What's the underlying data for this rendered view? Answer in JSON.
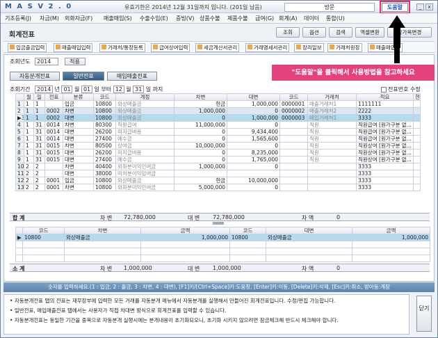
{
  "app": {
    "logo": "M A S  V 2 . 0",
    "notice": "유효기한은 2014년 12월 31일까지 입니다. (201일 남음)",
    "visitor": "방문",
    "help": "도움말",
    "win_min": "_",
    "win_close": "x"
  },
  "menu": [
    "기초등록(J)",
    "자금(M)",
    "외화자금(F)",
    "매출매입(S)",
    "수출수입(E)",
    "증빙(V)",
    "상품수불",
    "제품수불",
    "급여(G)",
    "회계(A)",
    "데이터",
    "통합(U)"
  ],
  "page": {
    "title": "회계전표",
    "buttons": [
      "조회",
      "옵션",
      "검색",
      "엑셀변환",
      "장가목변경"
    ]
  },
  "toolbar2": [
    "입금출금입력",
    "매출매입입력",
    "거래처/통장등록",
    "급여상여입력",
    "세금계산서관리",
    "거래명세서관리",
    "장리일보",
    "거래처원장",
    "매출매입장"
  ],
  "year": {
    "label": "조회년도",
    "value": "2014",
    "apply": "적용"
  },
  "tabs": [
    "자동분개전표",
    "일반전표",
    "매입매출전표"
  ],
  "period": {
    "label": "조회기간",
    "y1": "2014",
    "y_unit": "년",
    "m1": "01",
    "m_unit": "월",
    "d1": "01",
    "d_unit": "일",
    "from_to": "부터",
    "m2": "12",
    "d2": "31",
    "end": "일 까지",
    "checkbox": "전표번호 수정"
  },
  "grid1": {
    "headers": [
      "월",
      "일",
      "전표",
      "분류",
      "코드",
      "계정",
      "차변",
      "대변",
      "코드",
      "거래처",
      "적요",
      "현장"
    ],
    "rows": [
      [
        "1",
        "1",
        "",
        "입금",
        "10800",
        "외상매출금",
        "현금",
        "1,000,000",
        "0000001",
        "매출거래처1",
        "1111111",
        ""
      ],
      [
        "1",
        "1",
        "0002",
        "차변",
        "10800",
        "외상매출금",
        "1,000,000",
        "0",
        "0000002",
        "매출거래처2",
        "2222",
        ""
      ],
      [
        "1",
        "1",
        "0002",
        "대변",
        "10800",
        "외상매출금",
        "0",
        "1,000,000",
        "0000003",
        "매입거래처1",
        "3333",
        ""
      ],
      [
        "1",
        "31",
        "0014",
        "차변",
        "80300",
        "직원급여",
        "11,000,000",
        "0",
        "",
        "직원",
        "직원급여 [원가구분 없...",
        ""
      ],
      [
        "1",
        "31",
        "0014",
        "대변",
        "26200",
        "미지급비용",
        "0",
        "9,434,400",
        "",
        "직원",
        "직원급여 [원가구분 없...",
        ""
      ],
      [
        "1",
        "31",
        "0014",
        "대변",
        "27400",
        "예수금",
        "0",
        "1,565,600",
        "",
        "직원",
        "직원급여 [원가구분 없...",
        ""
      ],
      [
        "1",
        "31",
        "0015",
        "차변",
        "80500",
        "상여금",
        "10,000,000",
        "0",
        "",
        "직원",
        "직원상여 [원가구분 없...",
        ""
      ],
      [
        "1",
        "31",
        "0015",
        "대변",
        "26200",
        "미지급비용",
        "0",
        "8,235,000",
        "",
        "직원",
        "직원상여 [원가구분 없...",
        ""
      ],
      [
        "1",
        "31",
        "0015",
        "대변",
        "27400",
        "예수금",
        "0",
        "1,765,000",
        "",
        "직원",
        "직원상여 [원가구분 없...",
        ""
      ],
      [
        "2",
        "2",
        "",
        "차변",
        "40400",
        "외화분이익인여금",
        "1,000,000",
        "0",
        "",
        "",
        "3333",
        ""
      ],
      [
        "2",
        "2",
        "",
        "대변",
        "38000",
        "미처분이익잉여금",
        "",
        "",
        "",
        "",
        "3333",
        ""
      ],
      [
        "2",
        "2",
        "0001",
        "입금",
        "10800",
        "외상매출금",
        "현금",
        "10,000,000",
        "",
        "",
        "3333",
        ""
      ],
      [
        "2",
        "2",
        "0001",
        "차변",
        "10800",
        "외화분이익인여금",
        "5,000,000",
        "0",
        "",
        "",
        "3333",
        ""
      ]
    ],
    "sum": {
      "label": "합    계",
      "debit_label": "차    변",
      "debit": "72,780,000",
      "credit_label": "대    변",
      "credit": "72,780,000",
      "diff_label": "차    액",
      "diff": "0"
    }
  },
  "grid2": {
    "headers": [
      "코드",
      "차변",
      "금액",
      "코드",
      "대변",
      "금액"
    ],
    "rows": [
      [
        "10800",
        "외상매출금",
        "1,000,000",
        "10800",
        "외상매출금",
        "1,000,000"
      ]
    ],
    "sum": {
      "label": "소    계",
      "debit_label": "차    변",
      "debit": "1,000,000",
      "credit_label": "대    변",
      "credit": "1,000,000",
      "diff_label": "차    액",
      "diff": "0"
    }
  },
  "hint": "숫자를 입력하세요.(1 : 입금, 2 : 출금, 3 : 차변, 4 : 대변), [F1]키/[Ctrl+Space]키:도움창, [Enter]키:이동, [Delete]키:삭제, [Esc]키:취소, 방아동:계장",
  "notes": [
    "자동분개전표 탭의 전표는 재무장부에 입력한 모든 거래를 자동분개 메뉴에서 자동분개를 실행해서 만들어진 회계전표입니다. 수정/편집 가능합니다.",
    "일반전표, 매입매출전표 탭에서는 사용자가 직접 차대변 방식으로 회계전표를 입력할 수 있습니다.",
    "자동분개전표는 동일한 기간을 중복으로 자동분개 실행시에는 분개내용이 초기화되오니, 초기화 시키지 않으려면 잠금체크해 반드시 체크해야 합니다."
  ],
  "close_label": "닫기",
  "callout": "\"도움말\"을 클릭해서 사용방법을 참고하세요"
}
